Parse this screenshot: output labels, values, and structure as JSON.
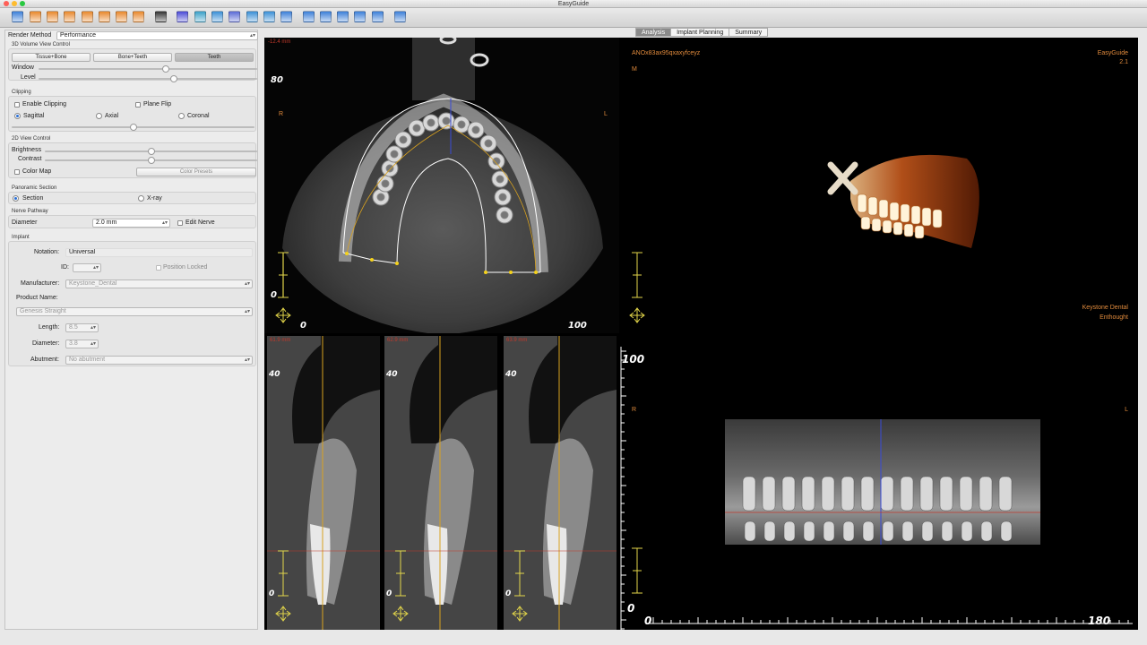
{
  "window": {
    "title": "EasyGuide"
  },
  "toolbar": {
    "icons": [
      "open-icon",
      "doc-icon",
      "doc-icon",
      "doc-icon",
      "doc-icon",
      "doc-icon",
      "doc-icon",
      "doc-icon",
      "film-icon",
      "tooth-icon",
      "xray-icon",
      "person-icon",
      "ruler-icon",
      "pen-icon",
      "measure-icon",
      "screen-icon",
      "layout-icon",
      "grid-icon",
      "view-icon",
      "view-icon",
      "crop-icon",
      "scale-icon"
    ]
  },
  "tabs": [
    "Analysis",
    "Implant Planning",
    "Summary"
  ],
  "panel": {
    "render_method_label": "Render Method",
    "render_method_value": "Performance",
    "vol_title": "3D Volume View Control",
    "vol_buttons": [
      "Tissue+Bone",
      "Bone+Teeth",
      "Teeth"
    ],
    "window_label": "Window",
    "level_label": "Level",
    "window_level": 0.58,
    "level_level": 0.62,
    "clipping_title": "Clipping",
    "enable_clipping": "Enable Clipping",
    "plane_flip": "Plane Flip",
    "sagittal": "Sagittal",
    "axial": "Axial",
    "coronal": "Coronal",
    "clip_level": 0.5,
    "view2d_title": "2D View Control",
    "brightness": "Brightness",
    "contrast": "Contrast",
    "brightness_level": 0.5,
    "contrast_level": 0.5,
    "color_map": "Color Map",
    "color_presets": "Color Presets",
    "pano_title": "Panoramic Section",
    "section": "Section",
    "xray": "X-ray",
    "nerve_title": "Nerve Pathway",
    "diameter_label": "Diameter",
    "diameter_value": "2.0 mm",
    "edit_nerve": "Edit Nerve",
    "implant_title": "Implant",
    "notation_label": "Notation:",
    "notation_value": "Universal",
    "id_label": "ID:",
    "position_locked": "Position Locked",
    "manufacturer_label": "Manufacturer:",
    "manufacturer_value": "Keystone_Dental",
    "product_label": "Product Name:",
    "product_value": "Genesis Straight",
    "length_label": "Length:",
    "length_value": "8.5",
    "diam_label": "Diameter:",
    "diam_value": "3.8",
    "abutment_label": "Abutment:",
    "abutment_value": "No abutment"
  },
  "views": {
    "axial": {
      "mm": "-12.4 mm",
      "y_top": "80",
      "y_zero": "0",
      "x_zero": "0",
      "x_end": "100",
      "r": "R",
      "l": "L"
    },
    "cross": [
      {
        "mm": "61.9 mm",
        "top": "40",
        "zero": "0"
      },
      {
        "mm": "62.9 mm",
        "top": "40",
        "zero": "0"
      },
      {
        "mm": "63.9 mm",
        "top": "40",
        "zero": "0"
      }
    ],
    "right": {
      "patient": "ANOx83ax95qxaxyfceyz",
      "m": "M",
      "app": "EasyGuide",
      "version": "2.1",
      "vendor1": "Keystone Dental",
      "vendor2": "Enthought",
      "r": "R",
      "l": "L",
      "y_top": "100",
      "y_zero": "0",
      "x_zero": "0",
      "x_end": "180"
    }
  },
  "colors": {
    "accent": "#2a6fd6",
    "orange": "#e08a3c",
    "mm_red": "#c0392b",
    "guide": "#d9a21f"
  }
}
